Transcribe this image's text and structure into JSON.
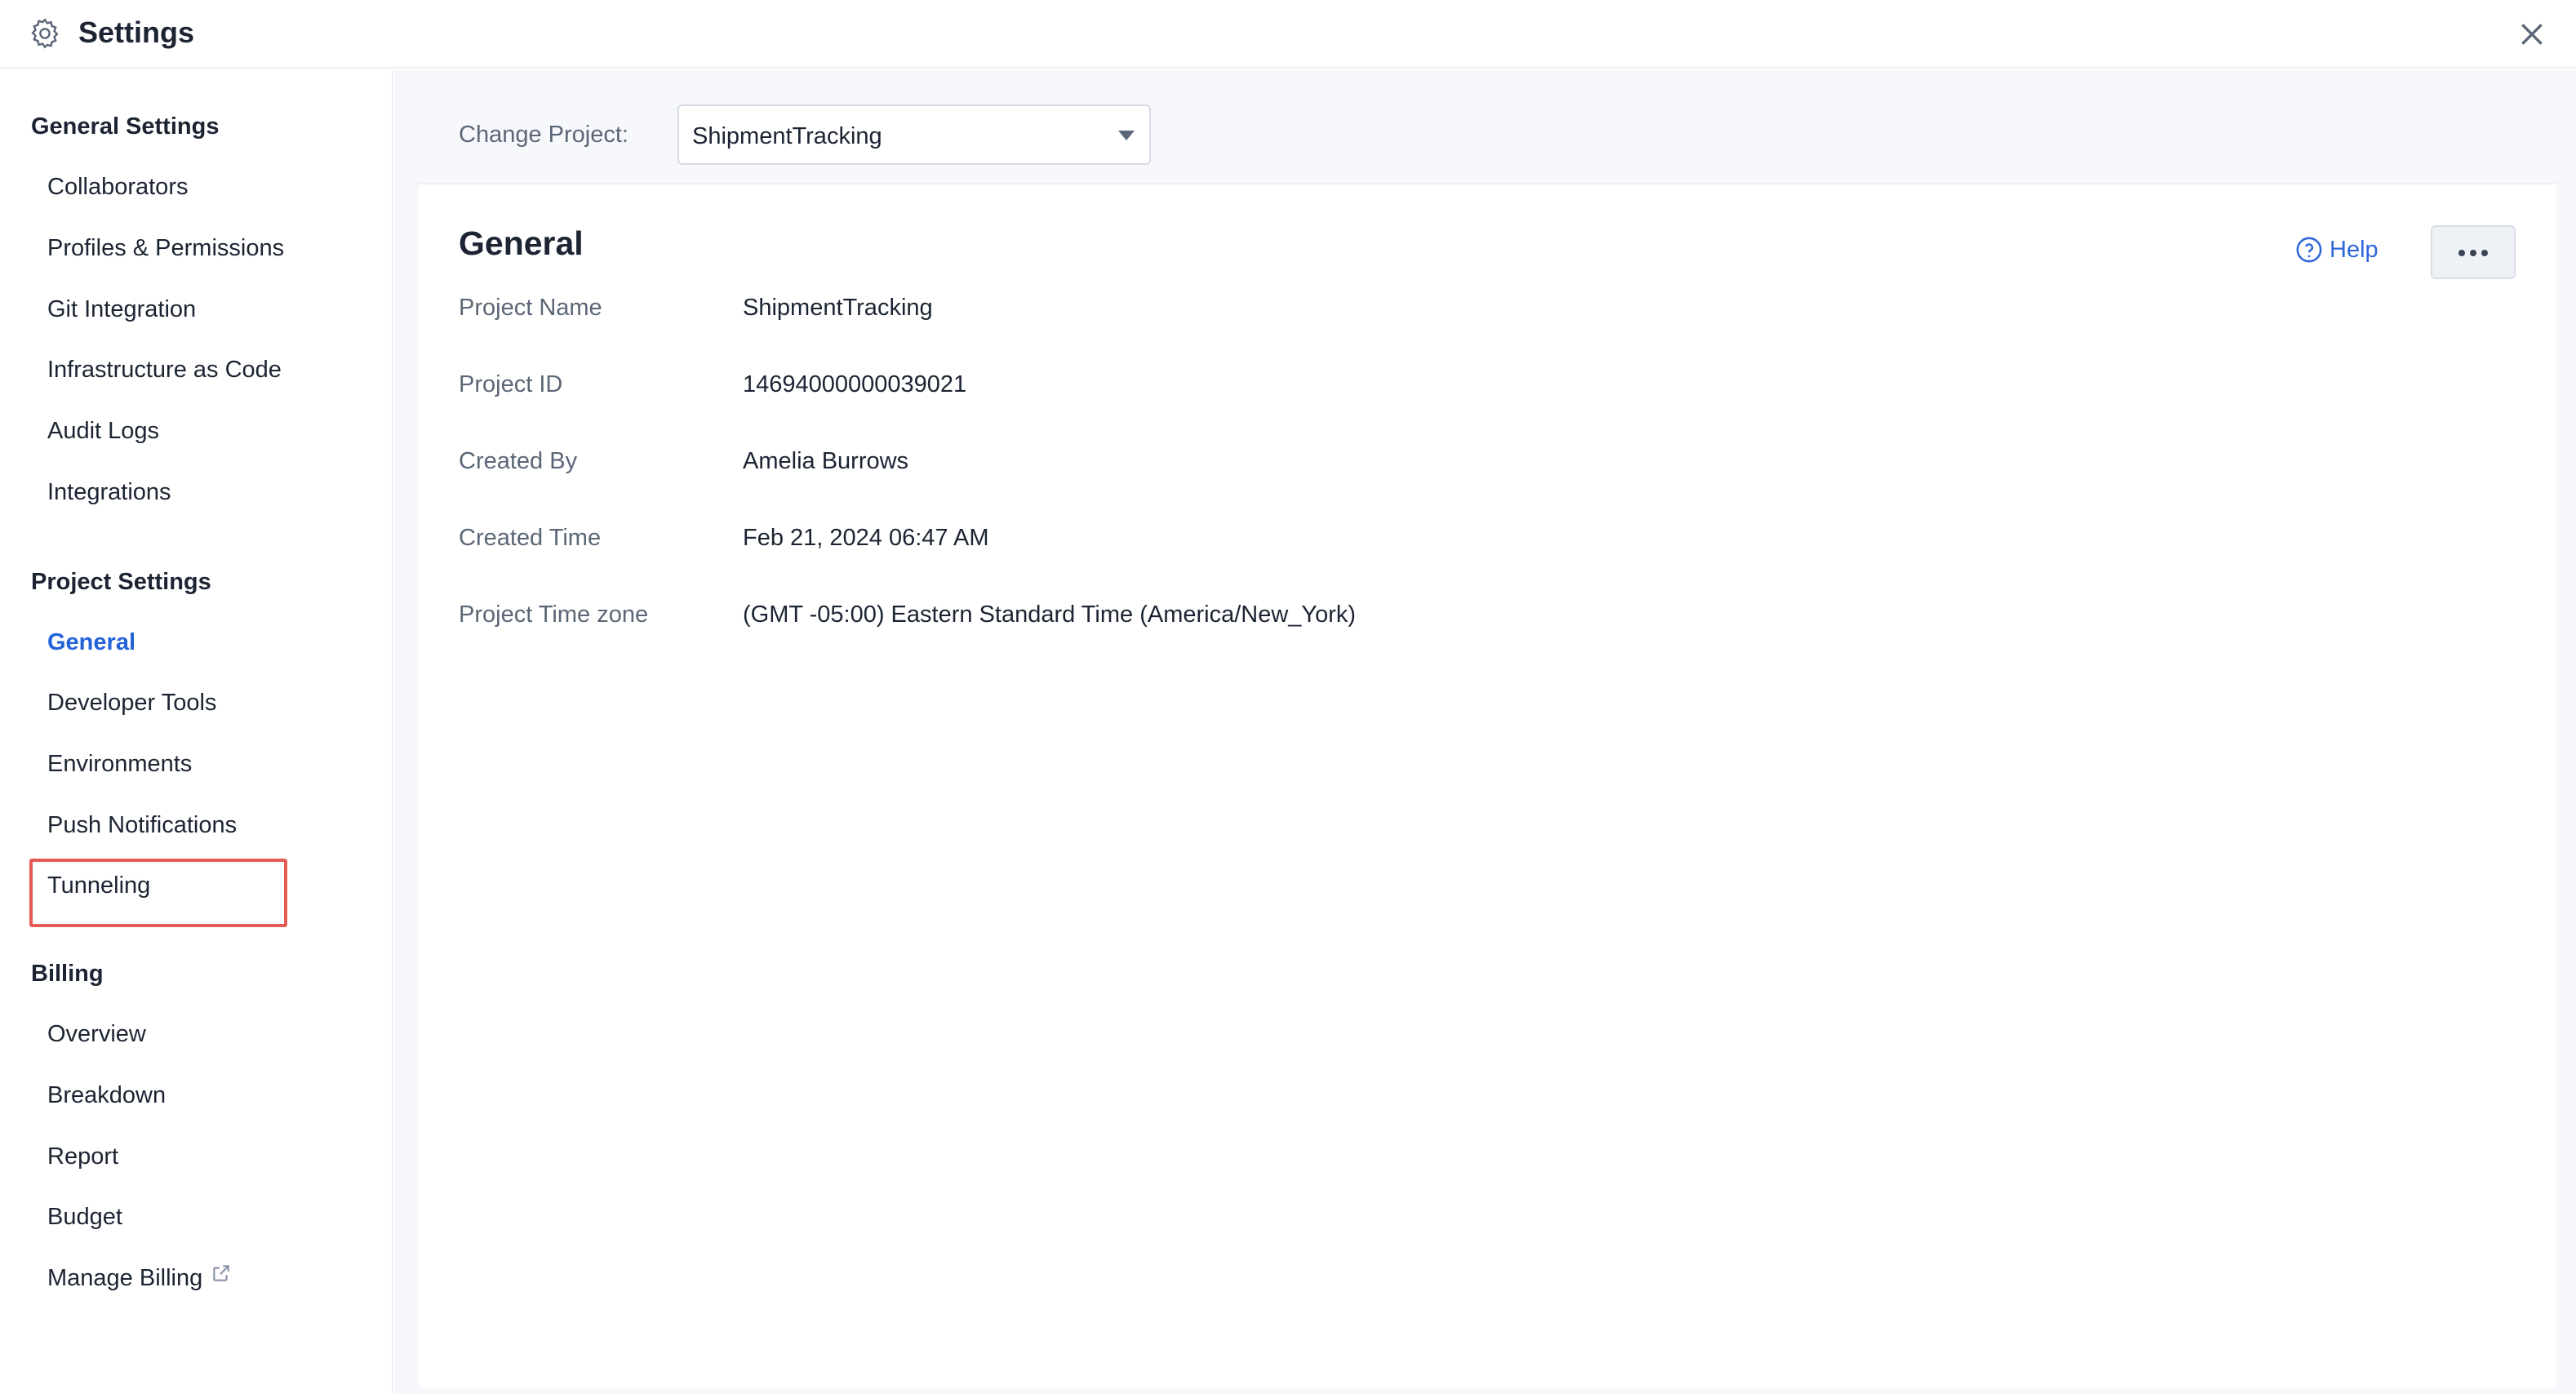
{
  "header": {
    "title": "Settings",
    "icon": "gear-icon",
    "close_icon": "close-icon"
  },
  "sidebar": {
    "general_settings": {
      "title": "General Settings",
      "items": [
        "Collaborators",
        "Profiles & Permissions",
        "Git Integration",
        "Infrastructure as Code",
        "Audit Logs",
        "Integrations"
      ]
    },
    "project_settings": {
      "title": "Project Settings",
      "items": [
        "General",
        "Developer Tools",
        "Environments",
        "Push Notifications",
        "Tunneling"
      ],
      "active": "General",
      "highlighted": "Tunneling"
    },
    "billing": {
      "title": "Billing",
      "items": [
        "Overview",
        "Breakdown",
        "Report",
        "Budget",
        "Manage Billing"
      ],
      "external_link_icon": "external-link-icon"
    }
  },
  "main": {
    "change_project_label": "Change Project:",
    "selected_project": "ShipmentTracking",
    "section_title": "General",
    "help_label": "Help",
    "fields": [
      {
        "label": "Project Name",
        "value": "ShipmentTracking"
      },
      {
        "label": "Project ID",
        "value": "14694000000039021"
      },
      {
        "label": "Created By",
        "value": "Amelia Burrows"
      },
      {
        "label": "Created Time",
        "value": "Feb 21, 2024 06:47 AM"
      },
      {
        "label": "Project Time zone",
        "value": "(GMT -05:00) Eastern Standard Time (America/New_York)"
      }
    ]
  },
  "colors": {
    "accent": "#2362d9",
    "highlight_border": "#e35b52",
    "text_primary": "#1c2433",
    "text_muted": "#5b6677"
  }
}
